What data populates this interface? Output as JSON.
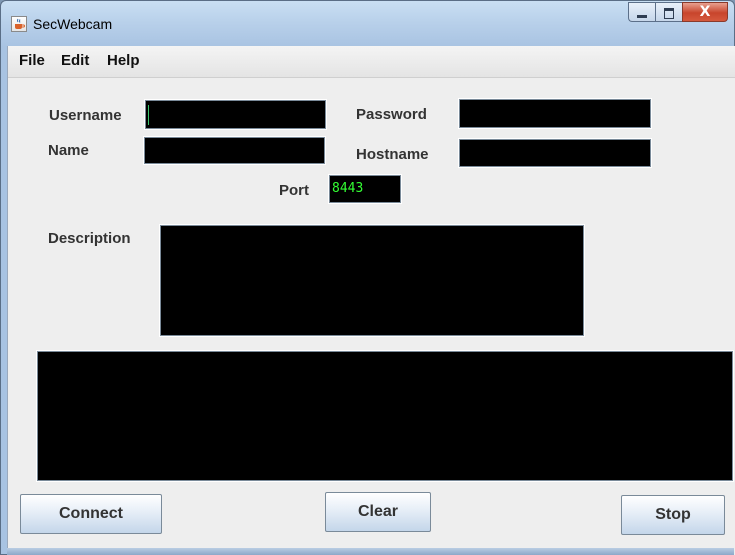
{
  "window": {
    "title": "SecWebcam",
    "controls": {
      "minimize": "minimize",
      "maximize": "maximize",
      "close": "close"
    }
  },
  "menubar": {
    "items": [
      "File",
      "Edit",
      "Help"
    ]
  },
  "form": {
    "username_label": "Username",
    "username_value": "",
    "password_label": "Password",
    "password_value": "",
    "name_label": "Name",
    "name_value": "",
    "hostname_label": "Hostname",
    "hostname_value": "",
    "port_label": "Port",
    "port_value": "8443",
    "description_label": "Description",
    "description_value": "",
    "log_output": ""
  },
  "buttons": {
    "connect": "Connect",
    "clear": "Clear",
    "stop": "Stop"
  },
  "colors": {
    "field_background": "#000000",
    "field_text": "#33ff33",
    "panel_background": "#eeeeee",
    "titlebar": "#b8d0ea"
  },
  "icons": {
    "app": "java-cup-icon"
  }
}
